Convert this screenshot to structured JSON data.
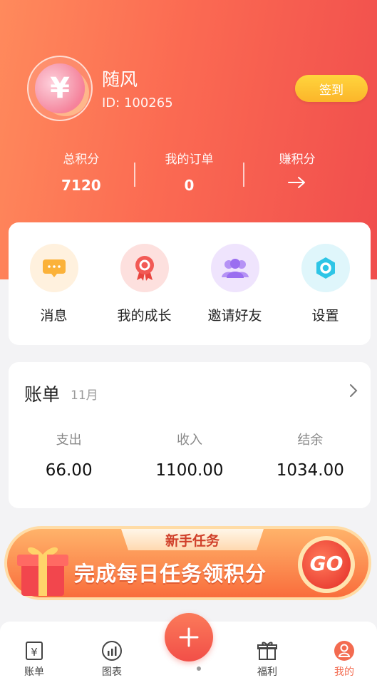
{
  "profile": {
    "name": "随风",
    "id_text": "ID: 100265",
    "avatar_glyph": "¥",
    "checkin_label": "签到"
  },
  "stats": [
    {
      "label": "总积分",
      "value": "7120"
    },
    {
      "label": "我的订单",
      "value": "0"
    },
    {
      "label": "赚积分",
      "value": ""
    }
  ],
  "quick_actions": [
    {
      "label": "消息",
      "icon": "message-icon",
      "color": "#fbb23a"
    },
    {
      "label": "我的成长",
      "icon": "medal-icon",
      "color": "#f25a55"
    },
    {
      "label": "邀请好友",
      "icon": "users-icon",
      "color": "#a67ef2"
    },
    {
      "label": "设置",
      "icon": "settings-icon",
      "color": "#2ec5e6"
    }
  ],
  "bill": {
    "title": "账单",
    "month": "11月",
    "columns": [
      {
        "label": "支出",
        "value": "66.00"
      },
      {
        "label": "收入",
        "value": "1100.00"
      },
      {
        "label": "结余",
        "value": "1034.00"
      }
    ]
  },
  "banner": {
    "tag": "新手任务",
    "text": "完成每日任务领积分",
    "button": "GO"
  },
  "tabbar": {
    "items": [
      {
        "label": "账单",
        "icon": "bill-icon"
      },
      {
        "label": "图表",
        "icon": "chart-icon"
      },
      {
        "label": "福利",
        "icon": "gift-icon"
      },
      {
        "label": "我的",
        "icon": "profile-icon"
      }
    ],
    "add_icon": "plus-icon",
    "accent": "#f36b50"
  }
}
